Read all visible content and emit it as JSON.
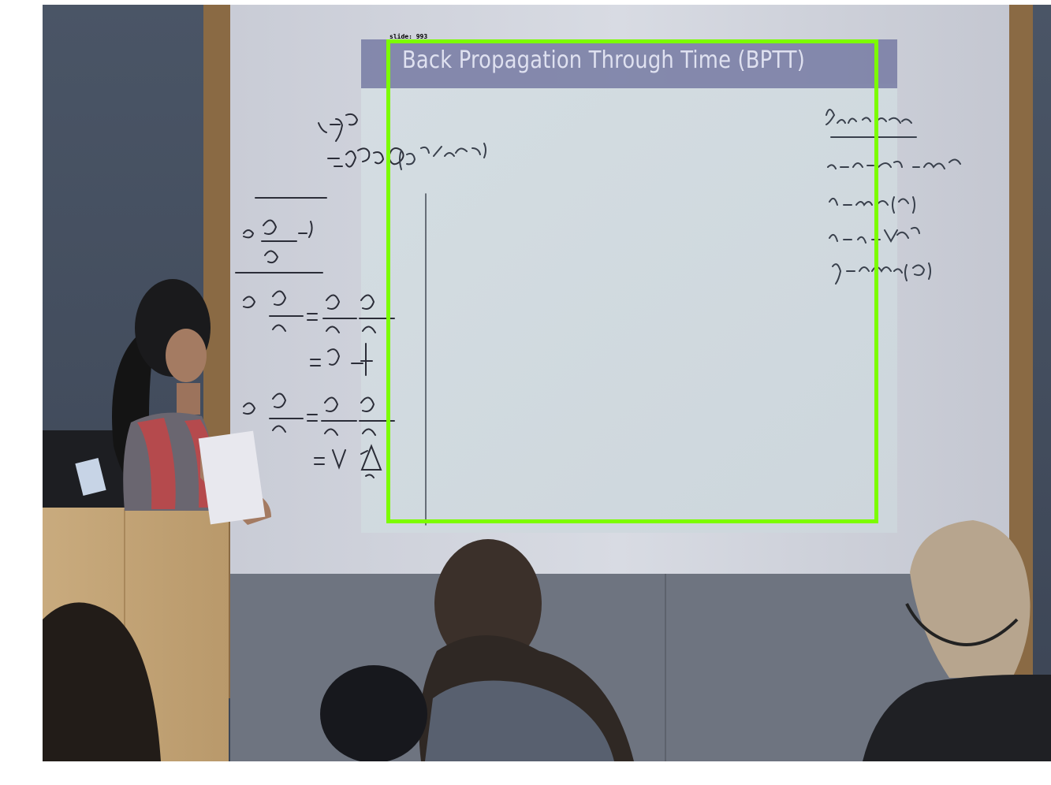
{
  "scene": {
    "slide_title": "Back Propagation Through Time (BPTT)",
    "detection_label": "slide: 993",
    "box_color": "#7cfc00"
  }
}
